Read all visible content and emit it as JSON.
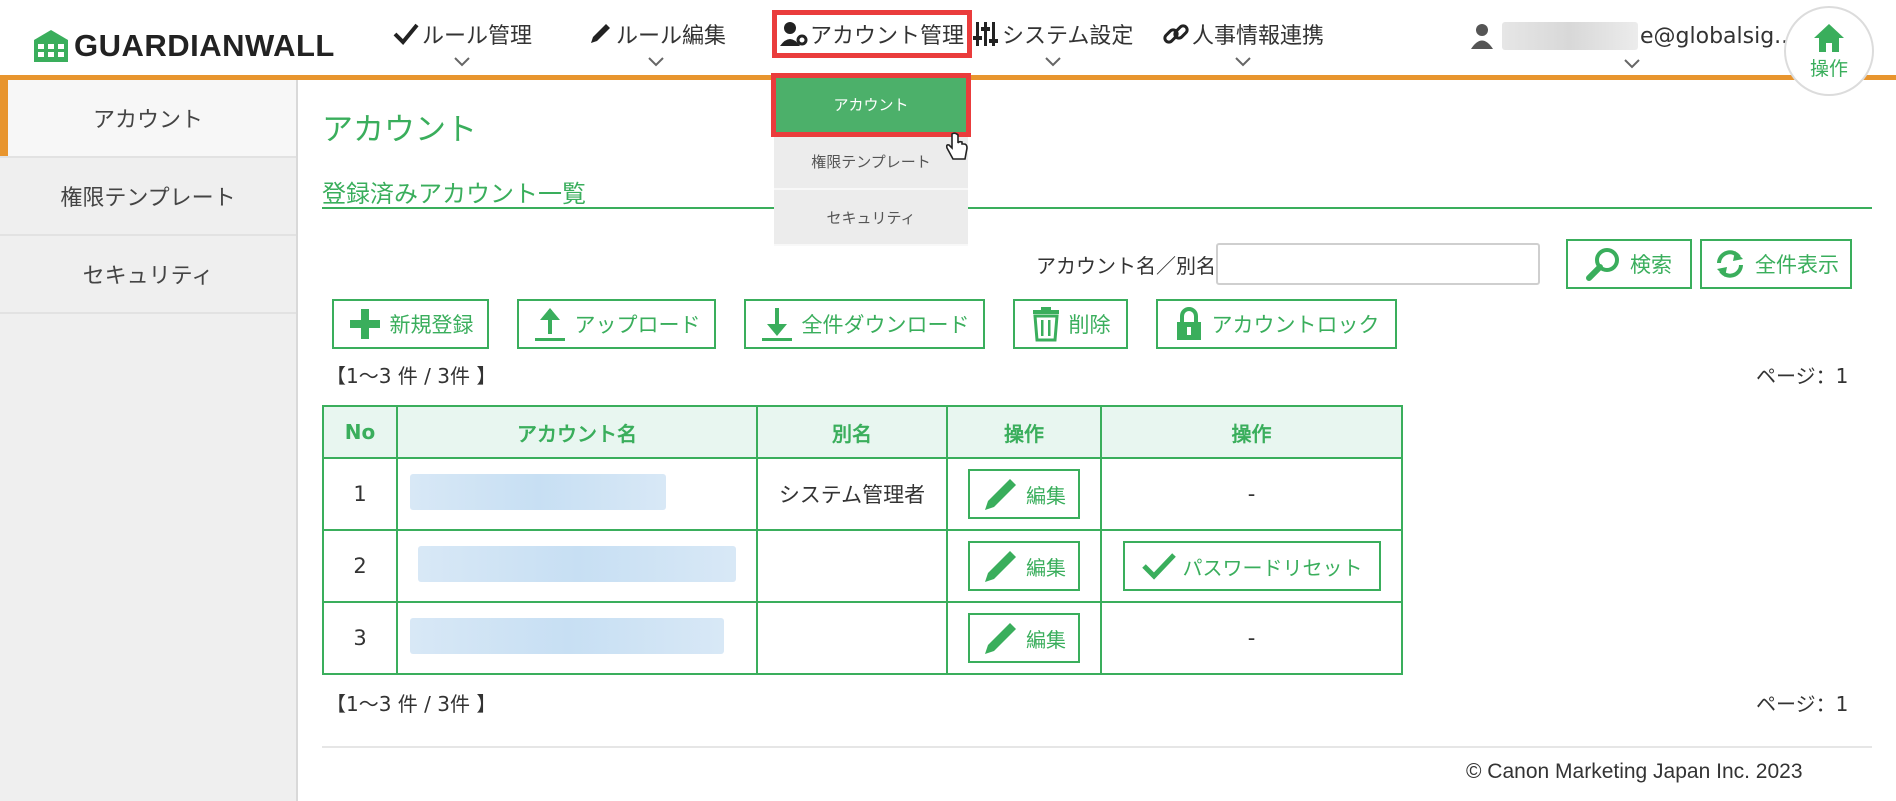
{
  "brand": {
    "logo_text": "GUARDIANWALL",
    "accent": "#3aae5c",
    "bar_color": "#e8952e"
  },
  "nav": {
    "items": [
      {
        "label": "ルール管理",
        "icon": "check-icon"
      },
      {
        "label": "ルール編集",
        "icon": "pencil-icon"
      },
      {
        "label": "アカウント管理",
        "icon": "user-gear-icon"
      },
      {
        "label": "システム設定",
        "icon": "sliders-icon"
      },
      {
        "label": "人事情報連携",
        "icon": "link-icon"
      }
    ],
    "user_email_suffix": "e@globalsig...",
    "home_label": "操作"
  },
  "dropdown": {
    "items": [
      "アカウント",
      "権限テンプレート",
      "セキュリティ"
    ]
  },
  "sidebar": {
    "items": [
      "アカウント",
      "権限テンプレート",
      "セキュリティ"
    ]
  },
  "main": {
    "page_title": "アカウント",
    "section_title": "登録済みアカウント一覧",
    "search_label": "アカウント名／別名",
    "search_value": "",
    "search_button": "検索",
    "show_all_button": "全件表示",
    "actions": {
      "new": "新規登録",
      "upload": "アップロード",
      "download_all": "全件ダウンロード",
      "delete": "削除",
      "lock": "アカウントロック"
    },
    "count_text": "【1～3 件 / 3件 】",
    "page_text": "ページ：1"
  },
  "table": {
    "headers": [
      "No",
      "アカウント名",
      "別名",
      "操作",
      "操作"
    ],
    "rows": [
      {
        "no": "1",
        "alias": "システム管理者",
        "edit": "編集",
        "extra": "-"
      },
      {
        "no": "2",
        "alias": "",
        "edit": "編集",
        "extra": "パスワードリセット"
      },
      {
        "no": "3",
        "alias": "",
        "edit": "編集",
        "extra": "-"
      }
    ]
  },
  "footer": {
    "copyright": "© Canon Marketing Japan Inc. 2023"
  }
}
